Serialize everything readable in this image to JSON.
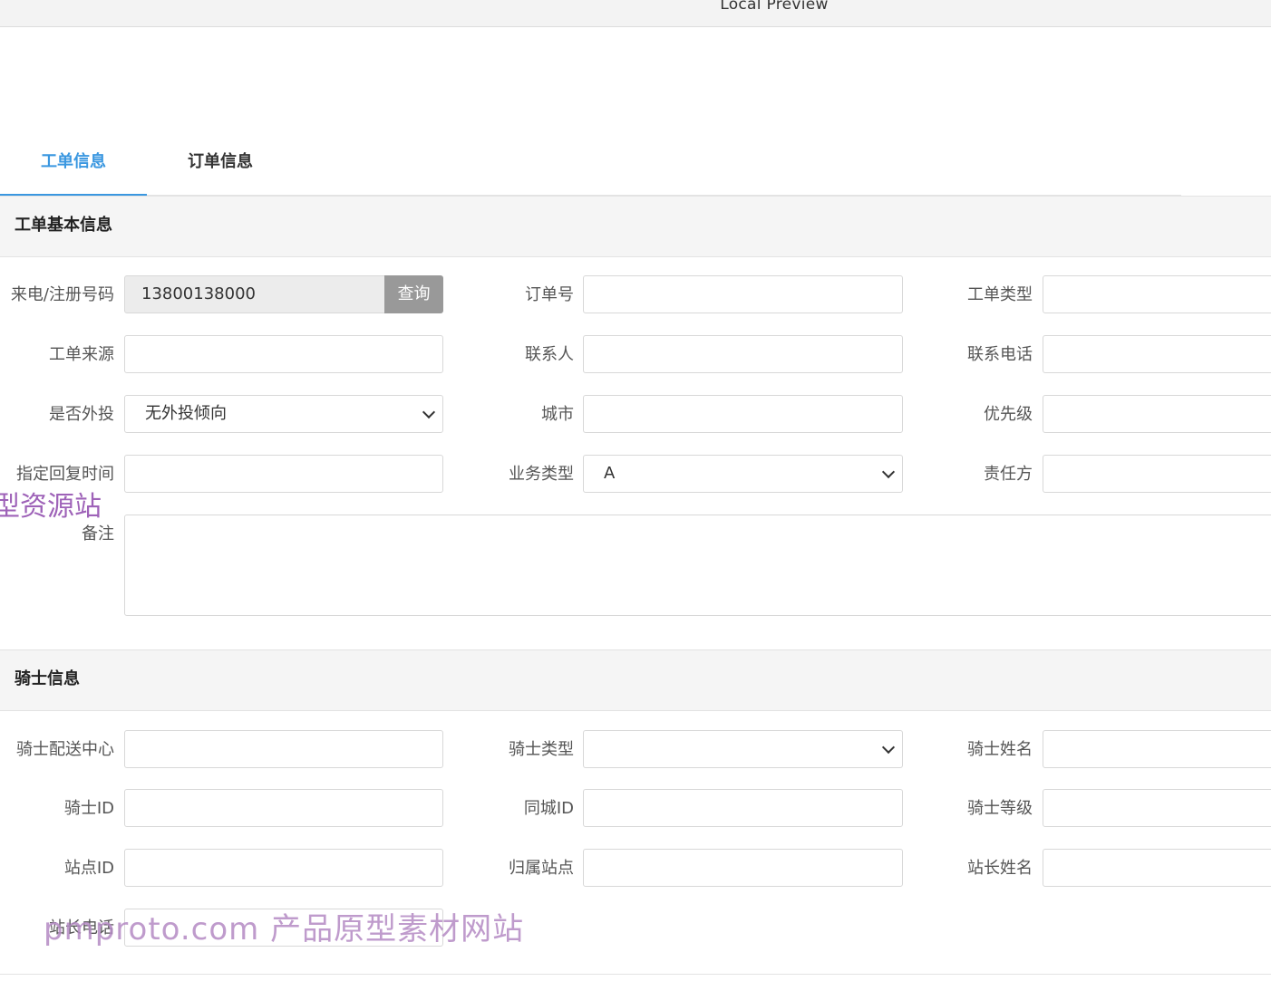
{
  "window": {
    "title": "Local Preview"
  },
  "tabs": [
    {
      "label": "工单信息",
      "active": true
    },
    {
      "label": "订单信息",
      "active": false
    }
  ],
  "colors": {
    "accent": "#3a97e0",
    "query_button": "#999999",
    "watermark": "#9e62b8"
  },
  "basic": {
    "section_title": "工单基本信息",
    "phone_label": "来电/注册号码",
    "phone_value": "13800138000",
    "query_label": "查询",
    "order_no_label": "订单号",
    "ticket_type_label": "工单类型",
    "ticket_source_label": "工单来源",
    "contact_label": "联系人",
    "contact_phone_label": "联系电话",
    "complaint_label": "是否外投",
    "complaint_value": "无外投倾向",
    "city_label": "城市",
    "priority_label": "优先级",
    "reply_time_label": "指定回复时间",
    "business_type_label": "业务类型",
    "business_type_value": "A",
    "responsible_label": "责任方",
    "remark_label": "备注"
  },
  "rider": {
    "section_title": "骑士信息",
    "center_label": "骑士配送中心",
    "type_label": "骑士类型",
    "name_label": "骑士姓名",
    "id_label": "骑士ID",
    "city_id_label": "同城ID",
    "level_label": "骑士等级",
    "station_id_label": "站点ID",
    "station_label": "归属站点",
    "station_master_label": "站长姓名",
    "station_phone_label": "站长电话"
  },
  "watermarks": {
    "side": "型资源站",
    "bottom": "pmproto.com 产品原型素材网站"
  }
}
